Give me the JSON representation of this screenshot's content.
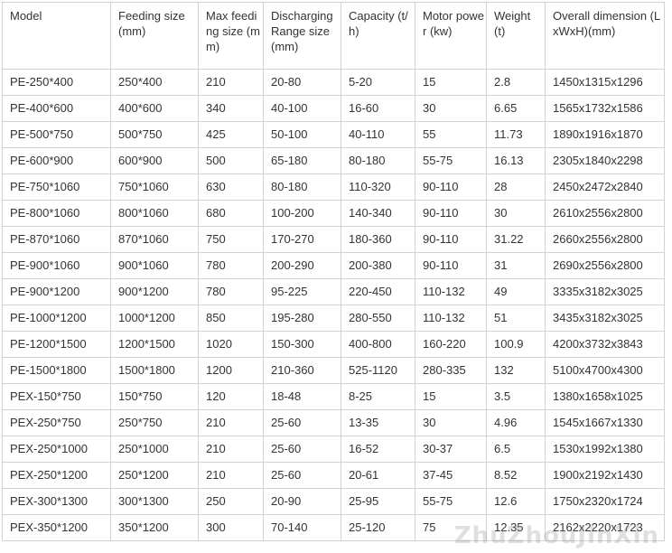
{
  "table": {
    "headers": [
      "Model",
      "Feeding size(mm)",
      "Max feeding size (mm)",
      "Discharging Range size(mm)",
      "Capacity (t/h)",
      "Motor power (kw)",
      "Weight (t)",
      "Overall dimension (LxWxH)(mm)"
    ],
    "rows": [
      [
        "PE-250*400",
        "250*400",
        "210",
        "20-80",
        "5-20",
        "15",
        "2.8",
        "1450x1315x1296"
      ],
      [
        "PE-400*600",
        "400*600",
        "340",
        "40-100",
        "16-60",
        "30",
        "6.65",
        "1565x1732x1586"
      ],
      [
        "PE-500*750",
        "500*750",
        "425",
        "50-100",
        "40-110",
        "55",
        "11.73",
        "1890x1916x1870"
      ],
      [
        "PE-600*900",
        "600*900",
        "500",
        "65-180",
        "80-180",
        "55-75",
        "16.13",
        "2305x1840x2298"
      ],
      [
        "PE-750*1060",
        "750*1060",
        "630",
        "80-180",
        "110-320",
        "90-110",
        "28",
        "2450x2472x2840"
      ],
      [
        "PE-800*1060",
        "800*1060",
        "680",
        "100-200",
        "140-340",
        "90-110",
        "30",
        "2610x2556x2800"
      ],
      [
        "PE-870*1060",
        "870*1060",
        "750",
        "170-270",
        "180-360",
        "90-110",
        "31.22",
        "2660x2556x2800"
      ],
      [
        "PE-900*1060",
        "900*1060",
        "780",
        "200-290",
        "200-380",
        "90-110",
        "31",
        "2690x2556x2800"
      ],
      [
        "PE-900*1200",
        "900*1200",
        "780",
        "95-225",
        "220-450",
        "110-132",
        "49",
        "3335x3182x3025"
      ],
      [
        "PE-1000*1200",
        "1000*1200",
        "850",
        "195-280",
        "280-550",
        "110-132",
        "51",
        "3435x3182x3025"
      ],
      [
        "PE-1200*1500",
        "1200*1500",
        "1020",
        "150-300",
        "400-800",
        "160-220",
        "100.9",
        "4200x3732x3843"
      ],
      [
        "PE-1500*1800",
        "1500*1800",
        "1200",
        "210-360",
        "525-1120",
        "280-335",
        "132",
        "5100x4700x4300"
      ],
      [
        "PEX-150*750",
        "150*750",
        "120",
        "18-48",
        "8-25",
        "15",
        "3.5",
        "1380x1658x1025"
      ],
      [
        "PEX-250*750",
        "250*750",
        "210",
        "25-60",
        "13-35",
        "30",
        "4.96",
        "1545x1667x1330"
      ],
      [
        "PEX-250*1000",
        "250*1000",
        "210",
        "25-60",
        "16-52",
        "30-37",
        "6.5",
        "1530x1992x1380"
      ],
      [
        "PEX-250*1200",
        "250*1200",
        "210",
        "25-60",
        "20-61",
        "37-45",
        "8.52",
        "1900x2192x1430"
      ],
      [
        "PEX-300*1300",
        "300*1300",
        "250",
        "20-90",
        "25-95",
        "55-75",
        "12.6",
        "1750x2320x1724"
      ],
      [
        "PEX-350*1200",
        "350*1200",
        "300",
        "70-140",
        "25-120",
        "75",
        "12.35",
        "2162x2220x1723"
      ]
    ]
  },
  "watermark": "ZhuZhouJinXin",
  "colors": {
    "border": "#d2d2d2",
    "text": "#333333",
    "background": "#ffffff",
    "watermark": "#8c8c8c"
  }
}
